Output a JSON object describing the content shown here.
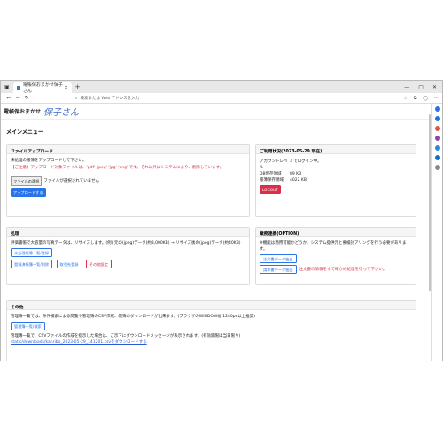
{
  "browser": {
    "tab_title": "電帳保おまかせ保子さん",
    "tab_close": "×",
    "new_tab": "+",
    "url_placeholder": "検索または Web アドレスを入力",
    "win_min": "—",
    "win_max": "▢",
    "win_close": "✕"
  },
  "header": {
    "app_name": "電帳保おまかせ",
    "logo_script": "保子さん"
  },
  "menu_title": "メインメニュー",
  "upload": {
    "title": "ファイルアップロード",
    "line1": "未処理の帳簿をアップロードして下さい。",
    "notice": "【ご注意】アップロード対象ファイルは、'pdf' 'jpeg' 'jpg' 'png' です。それ以外はシステムにより、削除しています。",
    "choose_file": "ファイルの選択",
    "no_file": "ファイルが選択されていません",
    "upload_button": "アップロードする"
  },
  "status": {
    "title": "ご利用状況(2023-05-29 現在)",
    "rows": [
      {
        "k": "アカウントレベル",
        "v": "3 でログイン中。"
      },
      {
        "k": "DB保存領域",
        "v": "89 KB"
      },
      {
        "k": "帳簿保存領域",
        "v": "4022 KB"
      }
    ],
    "logout": "LOGOUT"
  },
  "processing": {
    "title": "処理",
    "desc": "評価書帳で大容量の写真データは、リサイズします。(例) 元の(jpeg)データ(約3,000KB) → リサイズ後の(jpeg)データ(約40KB)",
    "btn_unprocessed": "未処理帳簿一覧/登録",
    "btn_registered": "登録済帳簿一覧/削除",
    "btn_customers": "取引先登録",
    "btn_other": "その他設定"
  },
  "business": {
    "title": "業務連携(OPTION)",
    "desc": "※機能は適用可能かどうか、システム提供元と要検討アリングを行う必要があります。",
    "btn_order": "注文書データ抽出",
    "btn_ledger": "請求書データ抽出",
    "note": "注文書の情報をすで確かめ処理を行って下さい。"
  },
  "other": {
    "title": "その他",
    "line1": "管理簿一覧では、条件検索による閲覧や管理簿のCSV作成、帳簿のダウンロードが出来ます。(ブラウザのWINDOW幅 1240px以上推奨)",
    "btn_ledger_list": "管理簿一覧/検索",
    "line2": "管理簿一覧で、CSVファイルの作成を指示した場合は、ご示下にダウンロードメッセージが表示されます。(有効期限は当日限り)",
    "download_link": "static/downloads/kanribo_2023-05-29_141201.csvをダウンロードする"
  }
}
